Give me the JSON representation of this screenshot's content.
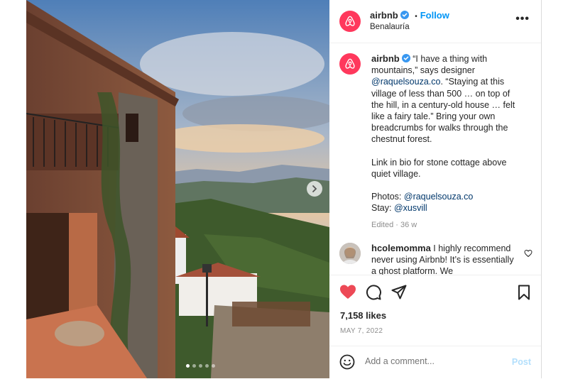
{
  "post": {
    "username": "airbnb",
    "follow_label": "Follow",
    "separator": "•",
    "location": "Benalauría",
    "more_label": "•••",
    "caption": {
      "username": "airbnb",
      "para1_a": "“I have a thing with mountains,” says designer ",
      "para1_mention": "@raquelsouza.co",
      "para1_b": ". “Staying at this village of less than 500 … on top of the hill, in a century-old house … felt like a fairy tale.” Bring your own breadcrumbs for walks through the chestnut forest.",
      "para2": "Link in bio for stone cottage above quiet village.",
      "photos_label": "Photos: ",
      "photos_mention": "@raquelsouza.co",
      "stay_label": "Stay: ",
      "stay_mention": "@xusvill",
      "edited": "Edited",
      "age": "36 w"
    },
    "comment": {
      "username": "hcolemomma",
      "text": " I highly recommend never using Airbnb! It’s is essentially a ghost platform. We"
    },
    "likes": "7,158 likes",
    "date": "MAY 7, 2022",
    "add_comment_placeholder": "Add a comment...",
    "post_label": "Post",
    "carousel": {
      "slides": 5,
      "active": 0
    }
  },
  "colors": {
    "brand": "#ff385c",
    "link": "#0095f6",
    "mention": "#00376b",
    "liked_heart": "#ed4956"
  },
  "icons": {
    "logo": "airbnb-logo-icon",
    "verified": "verified-badge-icon",
    "heart": "heart-icon",
    "comment": "comment-icon",
    "share": "share-icon",
    "save": "bookmark-icon",
    "emoji": "emoji-icon",
    "next": "chevron-right-icon"
  }
}
